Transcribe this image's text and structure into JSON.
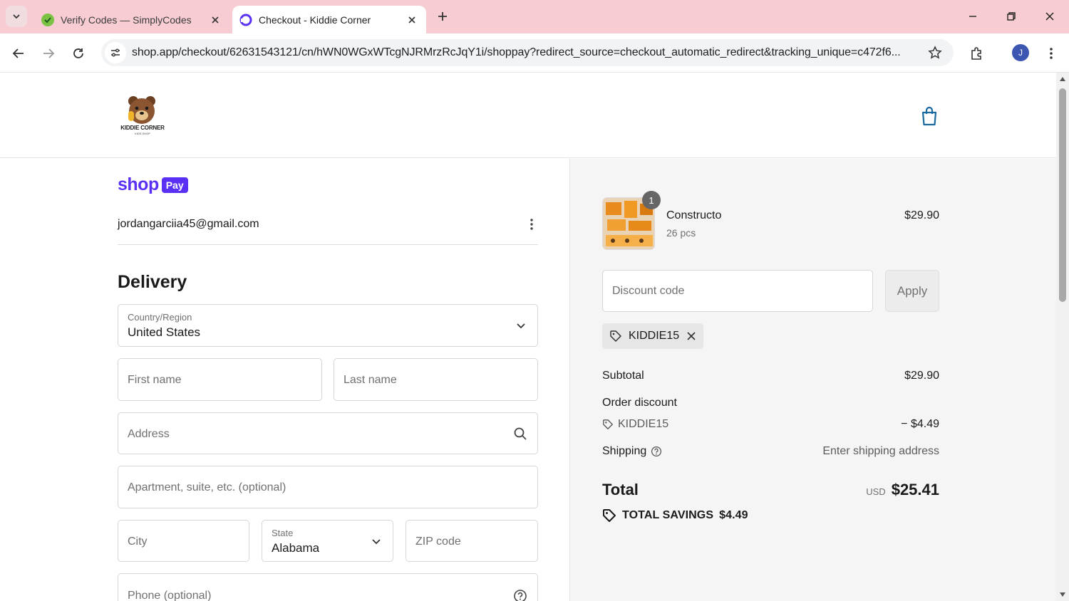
{
  "browser": {
    "tabs": [
      {
        "title": "Verify Codes — SimplyCodes",
        "active": false,
        "favicon": "simplycodes-icon"
      },
      {
        "title": "Checkout - Kiddie Corner",
        "active": true,
        "favicon": "shop-icon"
      }
    ],
    "url": "shop.app/checkout/62631543121/cn/hWN0WGxWTcgNJRMrzRcJqY1i/shoppay?redirect_source=checkout_automatic_redirect&tracking_unique=c472f6...",
    "profile_initial": "J",
    "accent": "#f7cdd3"
  },
  "store": {
    "logo_text": "KIDDIE CORNER",
    "logo_subtext": "KIDS SHOP"
  },
  "shop_pay": {
    "shop_word": "shop",
    "pay_badge": "Pay",
    "email": "jordangarciia45@gmail.com",
    "brand_color": "#5a31f4"
  },
  "delivery": {
    "heading": "Delivery",
    "country_label": "Country/Region",
    "country_value": "United States",
    "first_name_placeholder": "First name",
    "last_name_placeholder": "Last name",
    "address_placeholder": "Address",
    "apartment_placeholder": "Apartment, suite, etc. (optional)",
    "city_placeholder": "City",
    "state_label": "State",
    "state_value": "Alabama",
    "zip_placeholder": "ZIP code",
    "phone_placeholder": "Phone (optional)"
  },
  "summary": {
    "product": {
      "name": "Constructo",
      "variant": "26 pcs",
      "price": "$29.90",
      "quantity": "1"
    },
    "discount_placeholder": "Discount code",
    "apply_label": "Apply",
    "applied_code": "KIDDIE15",
    "subtotal_label": "Subtotal",
    "subtotal_value": "$29.90",
    "order_discount_label": "Order discount",
    "order_discount_code": "KIDDIE15",
    "order_discount_value": "− $4.49",
    "shipping_label": "Shipping",
    "shipping_value": "Enter shipping address",
    "total_label": "Total",
    "currency": "USD",
    "total_value": "$25.41",
    "savings_label": "TOTAL SAVINGS",
    "savings_value": "$4.49"
  }
}
